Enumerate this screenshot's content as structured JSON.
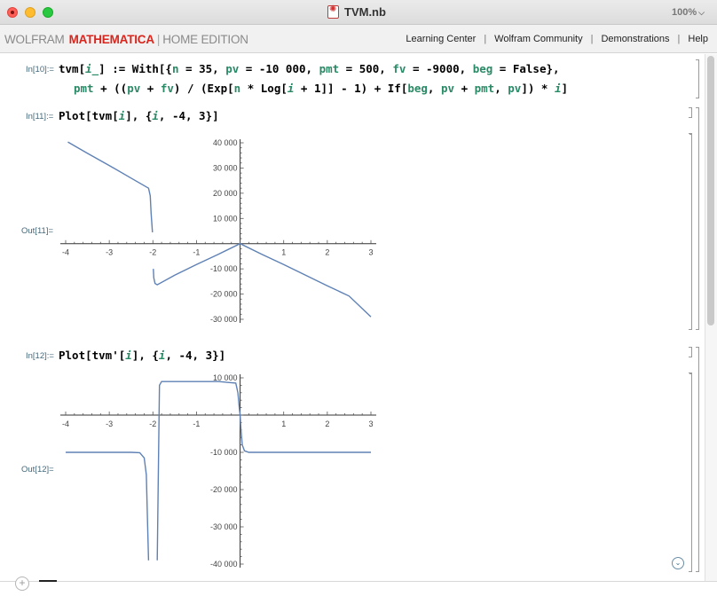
{
  "window": {
    "title": "TVM.nb",
    "zoom": "100%"
  },
  "toolbar": {
    "brand_part1": "WOLFRAM",
    "brand_part2": "MATHEMATICA",
    "brand_sep": "|",
    "brand_part3": "HOME EDITION",
    "links": [
      "Learning Center",
      "Wolfram Community",
      "Demonstrations",
      "Help"
    ]
  },
  "cells": {
    "in10": {
      "label": "In[10]:=",
      "line1": {
        "t1": "tvm[",
        "t2": "i_",
        "t3": "] := With[{",
        "t4": "n",
        "t5": " = 35, ",
        "t6": "pv",
        "t7": " = -10 000, ",
        "t8": "pmt",
        "t9": " = 500, ",
        "t10": "fv",
        "t11": " = -9000, ",
        "t12": "beg",
        "t13": " = False},"
      },
      "line2": {
        "t1": "pmt",
        "t2": " + ((",
        "t3": "pv",
        "t4": " + ",
        "t5": "fv",
        "t6": ") / (Exp[",
        "t7": "n",
        "t8": " * Log[",
        "t9": "i",
        "t10": " + 1]] - 1) + If[",
        "t11": "beg",
        "t12": ", ",
        "t13": "pv",
        "t14": " + ",
        "t15": "pmt",
        "t16": ", ",
        "t17": "pv",
        "t18": "]) * ",
        "t19": "i",
        "t20": "]"
      }
    },
    "in11": {
      "label": "In[11]:=",
      "code": {
        "t1": "Plot[tvm[",
        "t2": "i",
        "t3": "], {",
        "t4": "i",
        "t5": ", -4, 3}]"
      }
    },
    "out11": {
      "label": "Out[11]="
    },
    "in12": {
      "label": "In[12]:=",
      "code": {
        "t1": "Plot[tvm'[",
        "t2": "i",
        "t3": "], {",
        "t4": "i",
        "t5": ", -4, 3}]"
      }
    },
    "out12": {
      "label": "Out[12]="
    }
  },
  "chart_data": [
    {
      "type": "line",
      "xlim": [
        -4,
        3
      ],
      "ylim": [
        -30000,
        40000
      ],
      "x_ticks": [
        -4,
        -3,
        -2,
        -1,
        1,
        2,
        3
      ],
      "x_tick_labels": [
        "-4",
        "-3",
        "-2",
        "-1",
        "1",
        "2",
        "3"
      ],
      "y_ticks": [
        40000,
        30000,
        20000,
        10000,
        -10000,
        -20000,
        -30000
      ],
      "y_tick_labels": [
        "40 000",
        "30 000",
        "20 000",
        "10 000",
        "-10 000",
        "-20 000",
        "-30 000"
      ],
      "series": [
        {
          "x": [
            -3.95,
            -3.5,
            -3.0,
            -2.5,
            -2.1,
            -2.06,
            -2.04,
            -2.02,
            -2.01
          ],
          "y": [
            40300,
            35800,
            31000,
            26000,
            22000,
            19000,
            12000,
            7000,
            4500
          ]
        },
        {
          "x": [
            -1.99,
            -1.98,
            -1.95,
            -1.9,
            -1.5,
            -1.0,
            -0.5,
            0.0,
            0.5,
            1.0,
            1.5,
            2.0,
            2.5,
            3.0
          ],
          "y": [
            -10000,
            -13500,
            -15800,
            -16300,
            -12500,
            -8300,
            -4200,
            0,
            -4200,
            -8300,
            -12500,
            -16700,
            -20800,
            -29000
          ]
        }
      ],
      "line_color": "#5e81b5",
      "grid": false
    },
    {
      "type": "line",
      "xlim": [
        -4,
        3
      ],
      "ylim": [
        -40000,
        10000
      ],
      "x_ticks": [
        -4,
        -3,
        -2,
        -1,
        1,
        2,
        3
      ],
      "x_tick_labels": [
        "-4",
        "-3",
        "-2",
        "-1",
        "1",
        "2",
        "3"
      ],
      "y_ticks": [
        10000,
        -10000,
        -20000,
        -30000,
        -40000
      ],
      "y_tick_labels": [
        "10 000",
        "-10 000",
        "-20 000",
        "-30 000",
        "-40 000"
      ],
      "series": [
        {
          "x": [
            -4.0,
            -3.0,
            -2.5,
            -2.3,
            -2.2,
            -2.15,
            -2.12,
            -2.1
          ],
          "y": [
            -10000,
            -10000,
            -10000,
            -10100,
            -11500,
            -16000,
            -30000,
            -39000
          ]
        },
        {
          "x": [
            -1.9,
            -1.88,
            -1.85,
            -1.8,
            -1.5,
            -1.0,
            -0.5,
            -0.1,
            -0.05,
            -0.02,
            0.0,
            0.02,
            0.05,
            0.1,
            0.2,
            0.5,
            1.0,
            2.0,
            3.0
          ],
          "y": [
            -39000,
            -20000,
            8000,
            9000,
            9000,
            9000,
            9000,
            8600,
            6000,
            2000,
            0,
            -4000,
            -8000,
            -9600,
            -10000,
            -10000,
            -10000,
            -10000,
            -10000
          ]
        }
      ],
      "line_color": "#5e81b5",
      "grid": false
    }
  ]
}
